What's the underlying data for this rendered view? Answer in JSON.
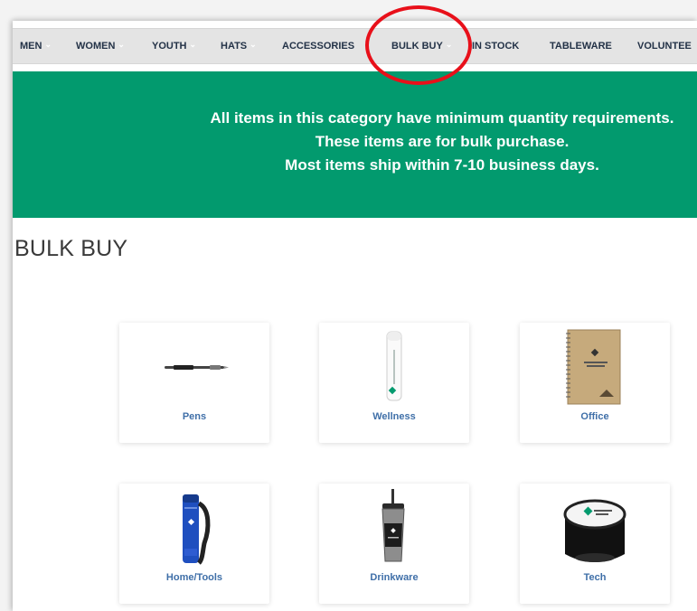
{
  "nav": {
    "items": [
      {
        "label": "MEN",
        "has_menu": true
      },
      {
        "label": "WOMEN",
        "has_menu": true
      },
      {
        "label": "YOUTH",
        "has_menu": true
      },
      {
        "label": "HATS",
        "has_menu": true
      },
      {
        "label": "ACCESSORIES",
        "has_menu": false
      },
      {
        "label": "BULK BUY",
        "has_menu": true,
        "highlighted": true
      },
      {
        "label": "IN STOCK",
        "has_menu": false
      },
      {
        "label": "TABLEWARE",
        "has_menu": false
      },
      {
        "label": "VOLUNTEE",
        "has_menu": false
      }
    ]
  },
  "banner": {
    "lines": [
      "All items in this category have minimum quantity requirements.",
      "These items are for bulk purchase.",
      "Most items ship within 7-10 business days."
    ],
    "color": "#029a6e"
  },
  "heading": "BULK BUY",
  "categories": [
    {
      "label": "Pens",
      "icon": "pen-icon"
    },
    {
      "label": "Wellness",
      "icon": "lip-balm-icon"
    },
    {
      "label": "Office",
      "icon": "notebook-icon"
    },
    {
      "label": "Home/Tools",
      "icon": "flashlight-icon"
    },
    {
      "label": "Drinkware",
      "icon": "tumbler-icon"
    },
    {
      "label": "Tech",
      "icon": "speaker-icon"
    }
  ],
  "highlight_color": "#e8101a"
}
